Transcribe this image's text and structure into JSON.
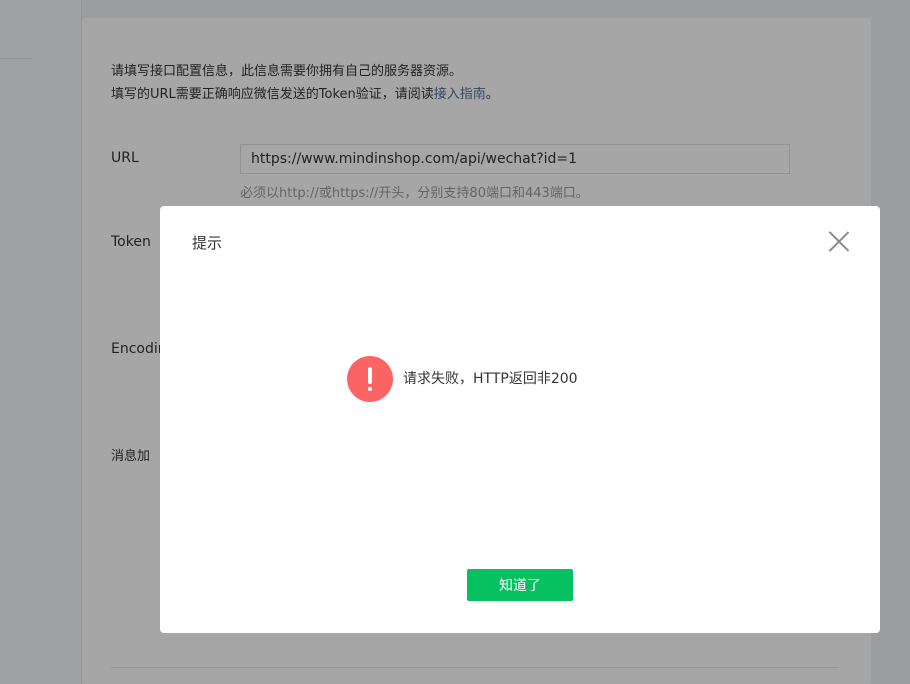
{
  "settings": {
    "intro_line1": "请填写接口配置信息，此信息需要你拥有自己的服务器资源。",
    "intro_line2_prefix": "填写的URL需要正确响应微信发送的Token验证，请阅读",
    "intro_link": "接入指南",
    "intro_line2_suffix": "。",
    "url_label": "URL",
    "url_value": "https://www.mindinshop.com/api/wechat?id=1",
    "url_hint": "必须以http://或https://开头，分别支持80端口和443端口。",
    "token_label": "Token",
    "encoding_label_visible": "Encodin",
    "encrypt_label_visible": "消息加"
  },
  "dialog": {
    "title": "提示",
    "message": "请求失败，HTTP返回非200",
    "confirm_label": "知道了",
    "icon": "warning-icon",
    "close_icon": "close-icon"
  },
  "colors": {
    "accent": "#07c160",
    "warning": "#fa6464",
    "link": "#576b95"
  }
}
